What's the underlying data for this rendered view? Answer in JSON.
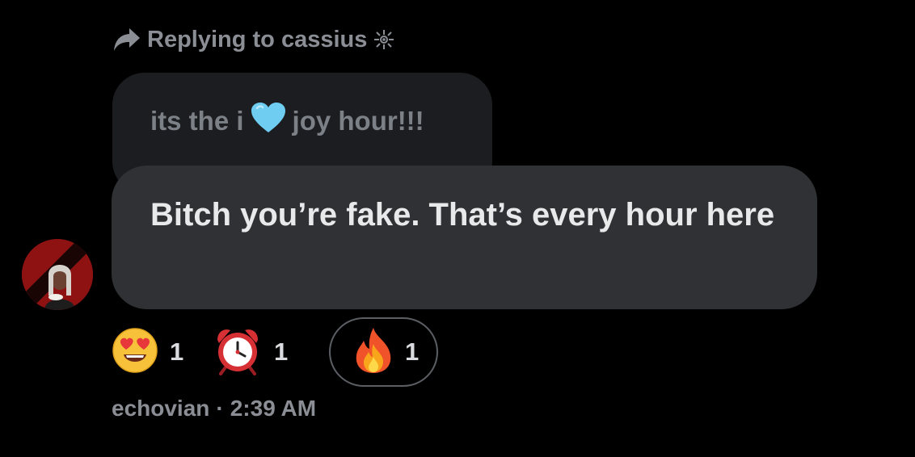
{
  "reply": {
    "prefix": "Replying to cassius",
    "icon": "sparkle-icon"
  },
  "quoted_message": {
    "text_before": "its the i",
    "emoji": "blue-heart",
    "text_after": "joy hour!!!"
  },
  "message": {
    "text": "Bitch you’re fake. That’s every hour here"
  },
  "reactions": [
    {
      "emoji": "heart-eyes",
      "count": "1",
      "selected": false
    },
    {
      "emoji": "alarm-clock",
      "count": "1",
      "selected": false
    },
    {
      "emoji": "fire",
      "count": "1",
      "selected": true
    }
  ],
  "footer": {
    "username": "echovian",
    "separator": "·",
    "time": "2:39 AM"
  },
  "colors": {
    "background": "#000000",
    "bubble": "#2f3134",
    "quoted_bubble": "#1c1d20",
    "muted_text": "#8b8f95"
  }
}
